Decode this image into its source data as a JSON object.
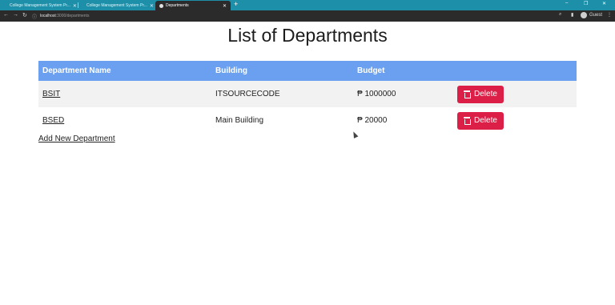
{
  "browser": {
    "tabs": [
      {
        "title": "College Management System Pr...",
        "active": false
      },
      {
        "title": "College Management System Pr...",
        "active": false
      },
      {
        "title": "Departments",
        "active": true
      }
    ],
    "new_tab": "+",
    "window_controls": {
      "minimize": "–",
      "maximize": "❐",
      "close": "✕"
    },
    "url": {
      "host": "localhost",
      "path": ":3000/departments"
    },
    "profile_label": "Guest"
  },
  "page": {
    "title": "List of Departments",
    "table": {
      "headers": [
        "Department Name",
        "Building",
        "Budget",
        ""
      ],
      "rows": [
        {
          "name": "BSIT",
          "building": "ITSOURCECODE",
          "budget": "₱ 1000000",
          "action": "Delete"
        },
        {
          "name": "BSED",
          "building": "Main Building",
          "budget": "₱ 20000",
          "action": "Delete"
        }
      ]
    },
    "add_link": "Add New Department"
  },
  "colors": {
    "header_bg": "#6aa0ef",
    "delete_button": "#dc1f46",
    "tabbar": "#1e8fa8",
    "toolbar": "#2b2b2b"
  }
}
